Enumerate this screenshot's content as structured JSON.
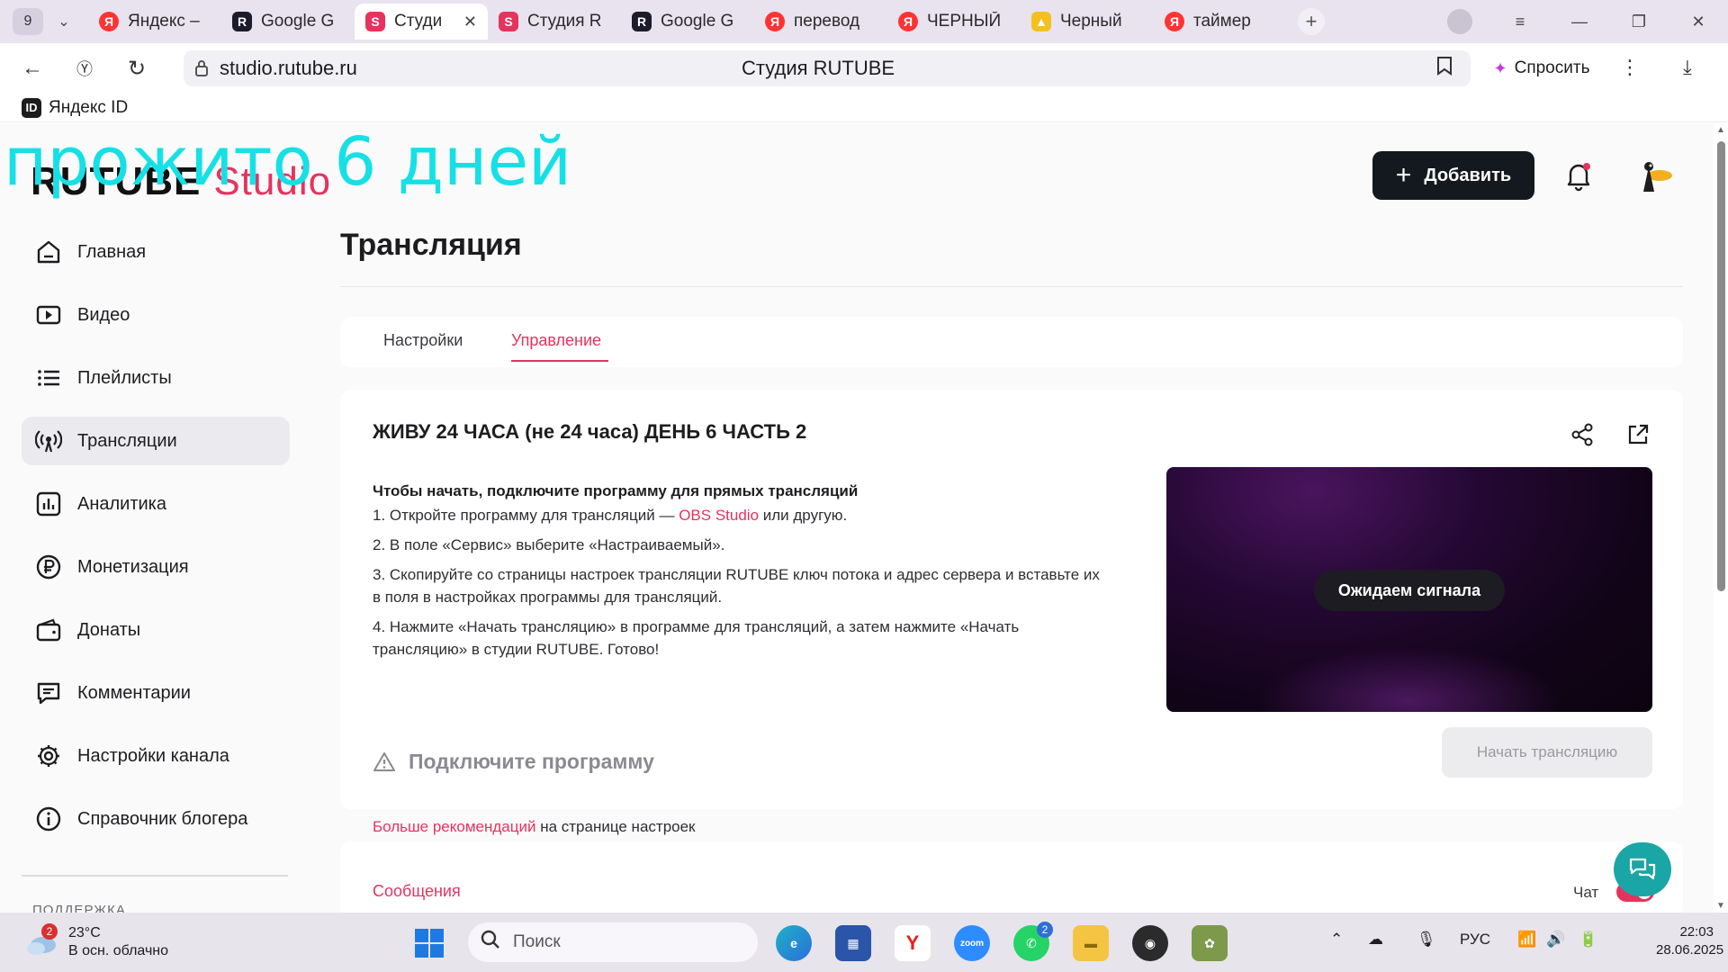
{
  "browser": {
    "tab_count": "9",
    "tabs": [
      {
        "label": "Яндекс –",
        "favicon": "yandex",
        "active": false
      },
      {
        "label": "Google G",
        "favicon": "rutube",
        "active": false
      },
      {
        "label": "Студи",
        "favicon": "studio",
        "active": true
      },
      {
        "label": "Студия R",
        "favicon": "studio",
        "active": false
      },
      {
        "label": "Google G",
        "favicon": "rutube",
        "active": false
      },
      {
        "label": "перевод",
        "favicon": "yandex",
        "active": false
      },
      {
        "label": "ЧЕРНЫЙ",
        "favicon": "yandex",
        "active": false
      },
      {
        "label": "Черный",
        "favicon": "yandex-images",
        "active": false
      },
      {
        "label": "таймер",
        "favicon": "yandex",
        "active": false
      }
    ],
    "url": "studio.rutube.ru",
    "page_title": "Студия RUTUBE",
    "ask_label": "Спросить",
    "bookmark": "Яндекс ID"
  },
  "overlay_text": "прожито 6 дней",
  "header": {
    "logo_main": "RUTUBE",
    "logo_sub": "Studio",
    "add_label": "Добавить"
  },
  "sidebar": {
    "items": [
      {
        "label": "Главная",
        "icon": "home-icon"
      },
      {
        "label": "Видео",
        "icon": "video-icon"
      },
      {
        "label": "Плейлисты",
        "icon": "playlist-icon"
      },
      {
        "label": "Трансляции",
        "icon": "broadcast-icon",
        "active": true
      },
      {
        "label": "Аналитика",
        "icon": "analytics-icon"
      },
      {
        "label": "Монетизация",
        "icon": "ruble-icon"
      },
      {
        "label": "Донаты",
        "icon": "wallet-icon"
      },
      {
        "label": "Комментарии",
        "icon": "comment-icon"
      },
      {
        "label": "Настройки канала",
        "icon": "gear-icon"
      },
      {
        "label": "Справочник блогера",
        "icon": "info-icon"
      }
    ],
    "support_label": "ПОДДЕРЖКА"
  },
  "main": {
    "title": "Трансляция",
    "tabs": [
      {
        "label": "Настройки"
      },
      {
        "label": "Управление",
        "active": true
      }
    ],
    "stream": {
      "title": "ЖИВУ 24 ЧАСА (не 24 часа) ДЕНЬ 6 ЧАСТЬ 2",
      "instructions_heading": "Чтобы начать, подключите программу для прямых трансляций",
      "step1_prefix": "1. Откройте программу для трансляций — ",
      "step1_link": "OBS Studio",
      "step1_suffix": " или другую.",
      "step2": "2. В поле «Сервис» выберите «Настраиваемый».",
      "step3": "3. Скопируйте со страницы настроек трансляции RUTUBE ключ потока и адрес сервера и вставьте их в поля в настройках программы для трансляций.",
      "step4": "4. Нажмите «Начать трансляцию» в программе для трансляций, а затем нажмите «Начать трансляцию» в студии RUTUBE. Готово!",
      "more_link": "Больше рекомендаций",
      "more_suffix": " на странице настроек",
      "warning": "Подключите программу",
      "preview_status": "Ожидаем сигнала",
      "start_label": "Начать трансляцию"
    },
    "messages": {
      "title": "Сообщения",
      "chat_label": "Чат",
      "chat_enabled": true
    }
  },
  "taskbar": {
    "weather_badge": "2",
    "temperature": "23°C",
    "condition": "В осн. облачно",
    "search_placeholder": "Поиск",
    "whatsapp_badge": "2",
    "language": "РУС",
    "time": "22:03",
    "date": "28.06.2025"
  },
  "colors": {
    "accent": "#e6335e",
    "overlay": "#16e0e6",
    "add_button": "#14191f"
  }
}
